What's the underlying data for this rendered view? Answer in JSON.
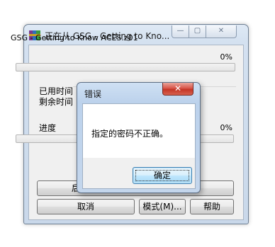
{
  "main_window": {
    "title": "正在从 GSG - Getting to Kno...",
    "controls": {
      "minimize": "—",
      "maximize": "▢",
      "close": "✕"
    },
    "file_name": "GSG - Getting to Know ACES.z01",
    "file_percent": "0%",
    "file_progress_fraction": 0,
    "elapsed_label": "已用时间",
    "remaining_label": "剩余时间",
    "progress_label": "进度",
    "total_percent": "0%",
    "total_progress_fraction": 0,
    "buttons": {
      "background": "后",
      "cancel": "取消",
      "mode": "模式(M)...",
      "help": "帮助"
    }
  },
  "error_dialog": {
    "title": "错误",
    "close": "✕",
    "message": "指定的密码不正确。",
    "ok_button": "确定"
  },
  "colors": {
    "progress_fill": "#2fb333",
    "close_button": "#c43526",
    "ok_button_border": "#3c7fb1"
  },
  "icons": {
    "app": "winrar-icon",
    "minimize": "minimize-icon",
    "maximize": "maximize-icon",
    "close": "close-icon"
  }
}
